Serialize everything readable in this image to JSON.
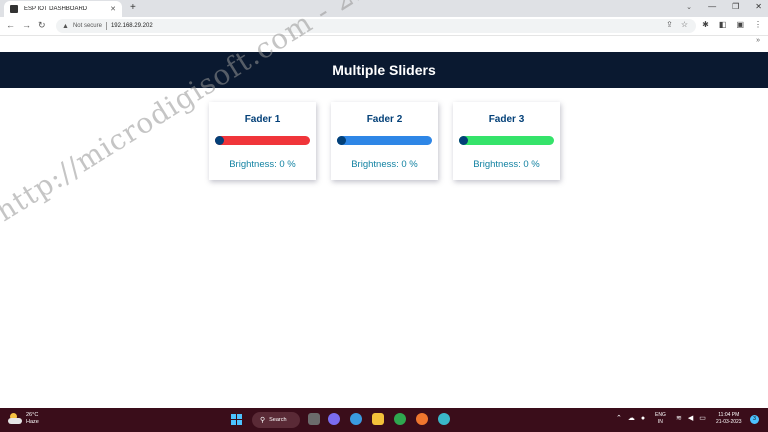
{
  "browser": {
    "tab_title": "ESP IOT DASHBOARD",
    "new_tab": "+",
    "not_secure": "Not secure",
    "url": "192.168.29.202"
  },
  "page": {
    "title": "Multiple Sliders",
    "cards": [
      {
        "title": "Fader 1",
        "state": "Brightness: 0 %",
        "value": 0,
        "color": "#f0353a"
      },
      {
        "title": "Fader 2",
        "state": "Brightness: 0 %",
        "value": 0,
        "color": "#2e86e6"
      },
      {
        "title": "Fader 3",
        "state": "Brightness: 0 %",
        "value": 0,
        "color": "#35e36a"
      }
    ]
  },
  "watermark": "http://microdigisoft.com - 22:19",
  "taskbar": {
    "temp": "26°C",
    "condition": "Haze",
    "search": "Search",
    "lang1": "ENG",
    "lang2": "IN",
    "time": "11:04 PM",
    "date": "21-03-2023",
    "notifications": "3"
  },
  "colors": {
    "nav_bg": "#0a1930",
    "card_title": "#034078",
    "card_state": "#1282a2",
    "thumb": "#034078",
    "taskbar_bg": "#3a0d1a"
  }
}
